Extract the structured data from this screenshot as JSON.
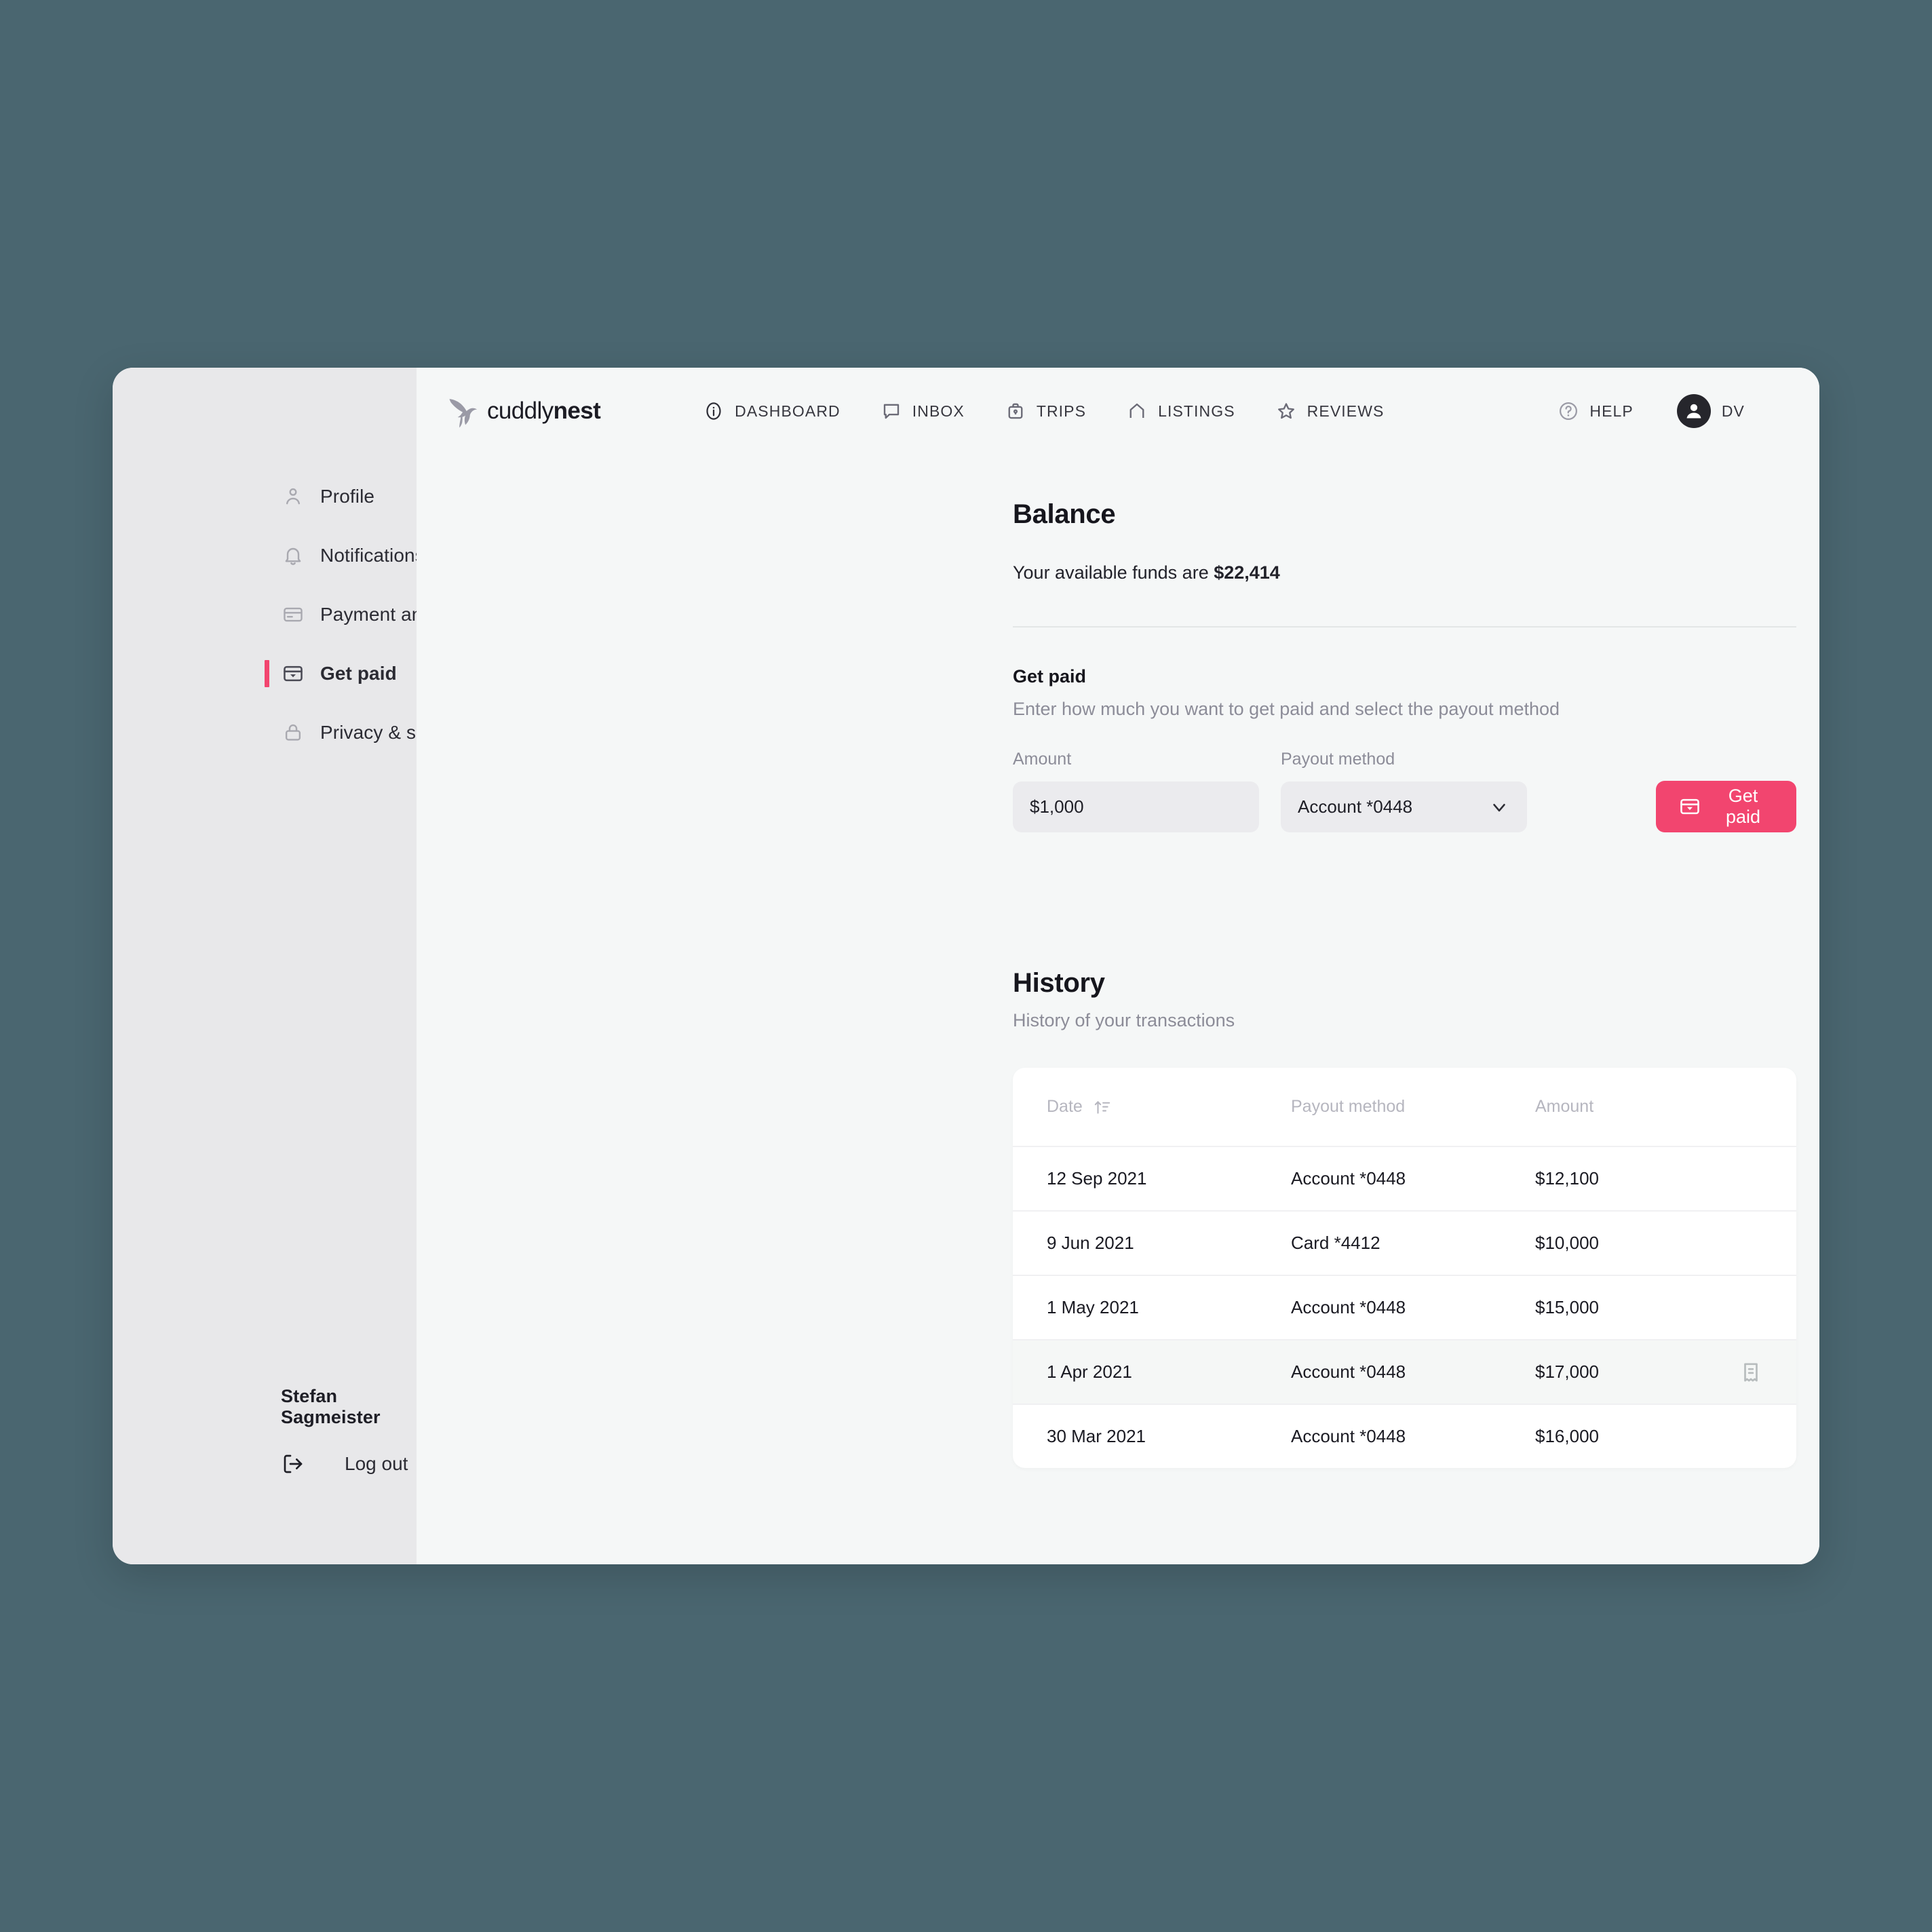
{
  "window": {
    "backdrop_color": "#4a6670",
    "sidebar_color": "#e8e8ea",
    "content_color": "#f5f7f7",
    "accent_color": "#f2456f"
  },
  "brand": {
    "name_light": "cuddly",
    "name_bold": "nest",
    "logo_icon": "hummingbird-icon"
  },
  "nav": {
    "items": [
      {
        "label": "DASHBOARD",
        "icon": "info-circle-icon"
      },
      {
        "label": "INBOX",
        "icon": "chat-bubble-icon"
      },
      {
        "label": "TRIPS",
        "icon": "suitcase-icon"
      },
      {
        "label": "LISTINGS",
        "icon": "house-icon"
      },
      {
        "label": "REVIEWS",
        "icon": "star-icon"
      }
    ],
    "help_label": "HELP",
    "help_icon": "question-circle-icon",
    "avatar_initials": "DV",
    "avatar_icon": "user-avatar-icon"
  },
  "sidebar": {
    "items": [
      {
        "label": "Profile",
        "icon": "person-icon",
        "active": false
      },
      {
        "label": "Notifications",
        "icon": "bell-icon",
        "active": false
      },
      {
        "label": "Payment and payout",
        "icon": "credit-card-icon",
        "active": false
      },
      {
        "label": "Get paid",
        "icon": "card-payout-icon",
        "active": true
      },
      {
        "label": "Privacy & security",
        "icon": "lock-icon",
        "active": false
      }
    ],
    "user_name": "Stefan Sagmeister",
    "logout_label": "Log out",
    "logout_icon": "sign-out-icon"
  },
  "balance": {
    "title": "Balance",
    "funds_prefix": "Your available funds are ",
    "funds_amount": "$22,414"
  },
  "get_paid": {
    "heading": "Get paid",
    "subheading": "Enter how much you want to get paid and select the payout method",
    "amount_label": "Amount",
    "amount_value": "$1,000",
    "amount_placeholder": "$1,000",
    "method_label": "Payout method",
    "method_value": "Account *0448",
    "method_options": [
      "Account *0448",
      "Card *4412"
    ],
    "button_label": "Get paid",
    "button_icon": "card-payout-icon",
    "chevron_icon": "chevron-down-icon"
  },
  "history": {
    "title": "History",
    "subtitle": "History of your transactions",
    "columns": {
      "date": "Date",
      "method": "Payout method",
      "amount": "Amount"
    },
    "sort_icon": "sort-ascending-icon",
    "rows": [
      {
        "date": "12 Sep 2021",
        "method": "Account *0448",
        "amount": "$12,100",
        "hovered": false,
        "receipt": false
      },
      {
        "date": "9 Jun 2021",
        "method": "Card *4412",
        "amount": "$10,000",
        "hovered": false,
        "receipt": false
      },
      {
        "date": "1 May 2021",
        "method": "Account *0448",
        "amount": "$15,000",
        "hovered": false,
        "receipt": false
      },
      {
        "date": "1 Apr 2021",
        "method": "Account *0448",
        "amount": "$17,000",
        "hovered": true,
        "receipt": true
      },
      {
        "date": "30 Mar 2021",
        "method": "Account *0448",
        "amount": "$16,000",
        "hovered": false,
        "receipt": false
      }
    ],
    "receipt_icon": "receipt-icon"
  }
}
